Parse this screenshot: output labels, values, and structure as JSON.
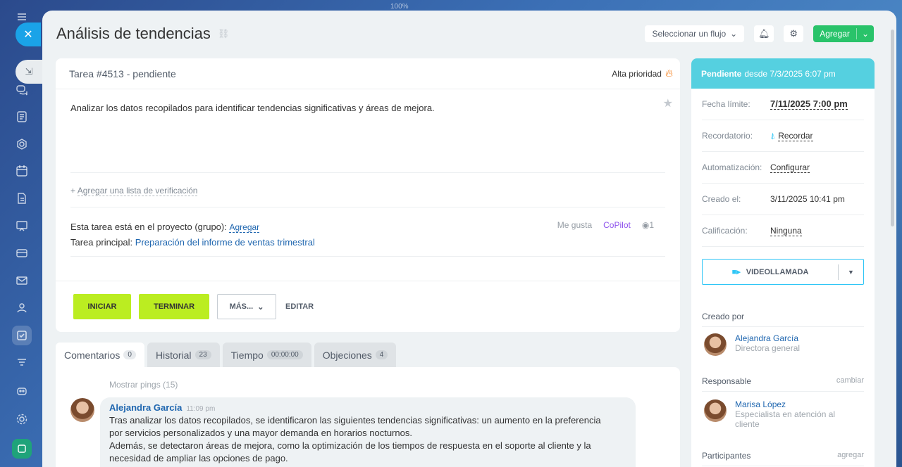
{
  "zoom": "100%",
  "rail": {
    "icons": [
      "menu-icon",
      "chat-icon",
      "feed-icon",
      "target-icon",
      "calendar-icon",
      "document-icon",
      "presentation-icon",
      "card-icon",
      "mail-icon",
      "contacts-icon",
      "tasks-icon",
      "filter-icon",
      "robot-icon",
      "settings-icon",
      "app-icon"
    ]
  },
  "header": {
    "title": "Análisis de tendencias",
    "flow_select": "Seleccionar un flujo",
    "add_label": "Agregar"
  },
  "task": {
    "id_status": "Tarea #4513 - pendiente",
    "priority": "Alta prioridad",
    "description": "Analizar los datos recopilados para identificar tendencias significativas y áreas de mejora.",
    "checklist_prefix": "+",
    "checklist_link": "Agregar una lista de verificación",
    "project_label": "Esta tarea está en el proyecto (grupo):",
    "project_add": "Agregar",
    "parent_label": "Tarea principal:",
    "parent_task": "Preparación del informe de ventas trimestral",
    "like": "Me gusta",
    "copilot": "CoPilot",
    "views": "1",
    "btn_start": "INICIAR",
    "btn_finish": "TERMINAR",
    "btn_more": "MÁS...",
    "btn_edit": "EDITAR"
  },
  "tabs": [
    {
      "label": "Comentarios",
      "count": "0"
    },
    {
      "label": "Historial",
      "count": "23"
    },
    {
      "label": "Tiempo",
      "count": "00:00:00"
    },
    {
      "label": "Objeciones",
      "count": "4"
    }
  ],
  "feed": {
    "pings": "Mostrar pings (15)",
    "comment": {
      "author": "Alejandra García",
      "time": "11:09 pm",
      "line1": "Tras analizar los datos recopilados, se identificaron las siguientes tendencias significativas: un aumento en la preferencia",
      "line2": "por servicios personalizados y una mayor demanda en horarios nocturnos.",
      "line3": "Además, se detectaron áreas de mejora, como la optimización de los tiempos de respuesta en el soporte al cliente y la",
      "line4": "necesidad de ampliar las opciones de pago."
    }
  },
  "side": {
    "status": "Pendiente",
    "status_since": "desde 7/3/2025 6:07 pm",
    "deadline_label": "Fecha límite:",
    "deadline": "7/11/2025 7:00 pm",
    "reminder_label": "Recordatorio:",
    "reminder": "Recordar",
    "automation_label": "Automatización:",
    "automation": "Configurar",
    "created_label": "Creado el:",
    "created": "3/11/2025 10:41 pm",
    "rating_label": "Calificación:",
    "rating": "Ninguna",
    "video": "VIDEOLLAMADA",
    "created_by": "Creado por",
    "creator_name": "Alejandra García",
    "creator_role": "Directora general",
    "responsible": "Responsable",
    "responsible_change": "cambiar",
    "resp_name": "Marisa López",
    "resp_role": "Especialista en atención al cliente",
    "participants": "Participantes",
    "participants_add": "agregar"
  }
}
